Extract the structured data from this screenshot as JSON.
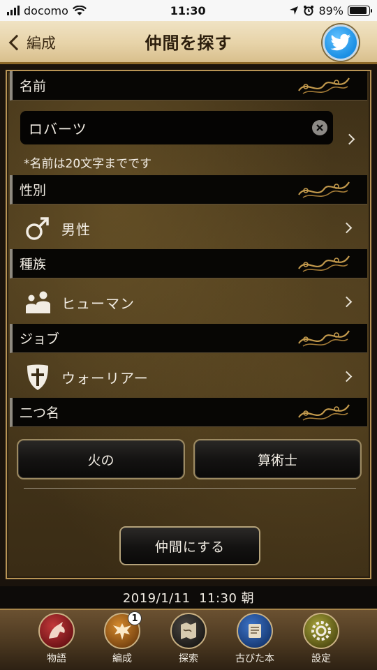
{
  "status_bar": {
    "carrier": "docomo",
    "time": "11:30",
    "battery": "89%",
    "battery_level": 0.89
  },
  "header": {
    "back_label": "編成",
    "title": "仲間を探す",
    "share_icon": "twitter-icon"
  },
  "sections": {
    "name": {
      "header": "名前",
      "value": "ロバーツ",
      "note": "*名前は20文字までです"
    },
    "gender": {
      "header": "性別",
      "value": "男性",
      "icon": "male-icon"
    },
    "race": {
      "header": "種族",
      "value": "ヒューマン",
      "icon": "human-icon"
    },
    "job": {
      "header": "ジョブ",
      "value": "ウォーリアー",
      "icon": "shield-icon"
    },
    "title": {
      "header": "二つ名",
      "prefix": "火の",
      "suffix": "算術士"
    }
  },
  "confirm_label": "仲間にする",
  "datebar": "2019/1/11  11:30 朝",
  "tabs": [
    {
      "label": "物語",
      "icon": "griffin-icon"
    },
    {
      "label": "編成",
      "icon": "eagle-icon",
      "badge": "1"
    },
    {
      "label": "探索",
      "icon": "map-icon"
    },
    {
      "label": "古びた本",
      "icon": "scroll-icon"
    },
    {
      "label": "設定",
      "icon": "gear-icon"
    }
  ],
  "colors": {
    "header_bg": "#e7d3a8",
    "panel_bg": "#3d2f17",
    "accent_gold": "#b89455",
    "section_bg": "#070604"
  }
}
